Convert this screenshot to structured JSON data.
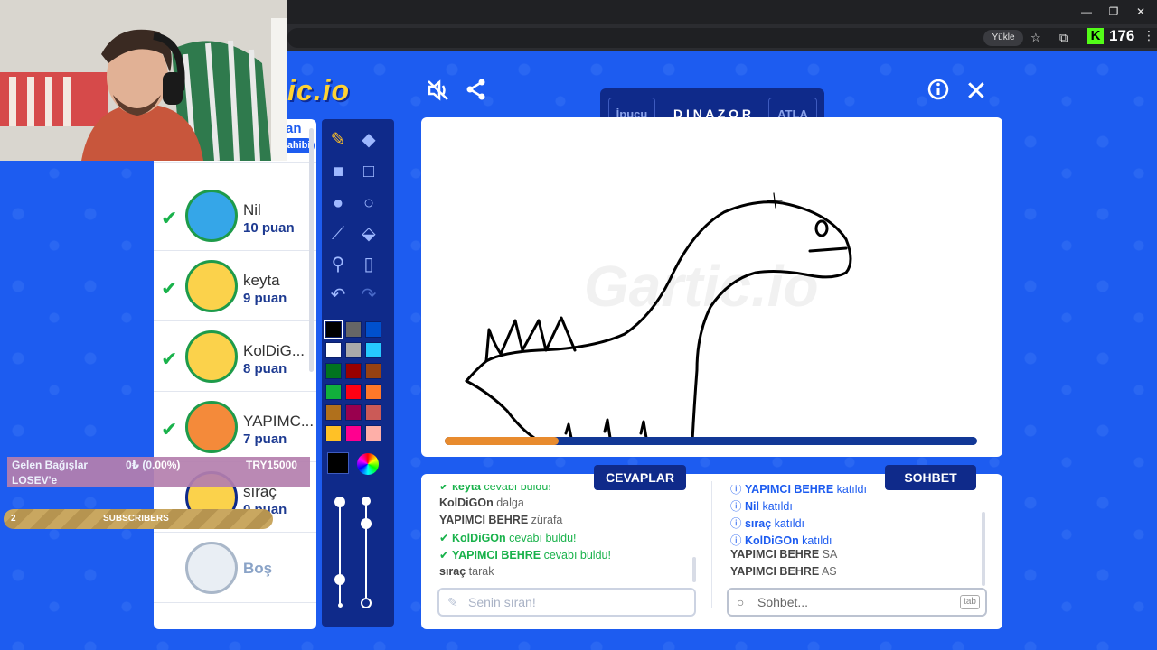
{
  "browser": {
    "upload_label": "Yükle",
    "counter": "176",
    "min_icon": "minimize-icon",
    "restore_icon": "restore-icon",
    "close_icon": "close-icon"
  },
  "game": {
    "logo_text": "ic.io",
    "word_bar": {
      "hint_label": "İpucu",
      "word": "D I N A Z O R",
      "skip_label": "ATLA"
    },
    "players": [
      {
        "name": "",
        "score": "",
        "badge": "Oda Sahibi",
        "checked": false
      },
      {
        "name": "Nil",
        "score": "10 puan",
        "checked": true
      },
      {
        "name": "keyta",
        "score": "9 puan",
        "checked": true
      },
      {
        "name": "KolDiG...",
        "score": "8 puan",
        "checked": true
      },
      {
        "name": "YAPIMC...",
        "score": "7 puan",
        "checked": true
      },
      {
        "name": "sıraç",
        "score": "0 puan",
        "checked": false
      },
      {
        "name": "Boş",
        "score": "",
        "checked": false
      }
    ],
    "partial_player_score_suffix": "an",
    "canvas_watermark": "Gartic.io",
    "answers_tab": "CEVAPLAR",
    "chat_tab": "SOHBET",
    "answers": [
      {
        "user": "keyta",
        "text": "cevabı buldu!",
        "found": true
      },
      {
        "user": "KolDiGOn",
        "text": "dalga",
        "found": false
      },
      {
        "user": "YAPIMCI BEHRE",
        "text": "zürafa",
        "found": false
      },
      {
        "user": "KolDiGOn",
        "text": "cevabı buldu!",
        "found": true
      },
      {
        "user": "YAPIMCI BEHRE",
        "text": "cevabı buldu!",
        "found": true
      },
      {
        "user": "sıraç",
        "text": "tarak",
        "found": false
      }
    ],
    "chat": [
      {
        "user": "YAPIMCI BEHRE",
        "text": "katıldı",
        "join": true
      },
      {
        "user": "Nil",
        "text": "katıldı",
        "join": true
      },
      {
        "user": "sıraç",
        "text": "katıldı",
        "join": true
      },
      {
        "user": "KolDiGOn",
        "text": "katıldı",
        "join": true
      },
      {
        "user": "YAPIMCI BEHRE",
        "text": "SA",
        "join": false
      },
      {
        "user": "YAPIMCI BEHRE",
        "text": "AS",
        "join": false
      }
    ],
    "answer_placeholder": "Senin sıran!",
    "chat_placeholder": "Sohbet...",
    "chat_key_hint": "tab",
    "timer_progress": 0.21,
    "palette": [
      "#000000",
      "#666666",
      "#0050cd",
      "#ffffff",
      "#aaaaaa",
      "#26c9ff",
      "#017420",
      "#990000",
      "#964112",
      "#11b03c",
      "#ff0013",
      "#ff7829",
      "#b0701c",
      "#99004e",
      "#cb5a57",
      "#ffc126",
      "#ff008f",
      "#feafa8"
    ],
    "current_color": "#000000"
  },
  "stream": {
    "donation_title": "Gelen Bağışlar",
    "donation_amount": "0₺ (0.00%)",
    "donation_goal": "TRY15000",
    "donation_target": "LOSEV'e",
    "subs_label": "SUBSCRIBERS",
    "subs_count": "2"
  }
}
